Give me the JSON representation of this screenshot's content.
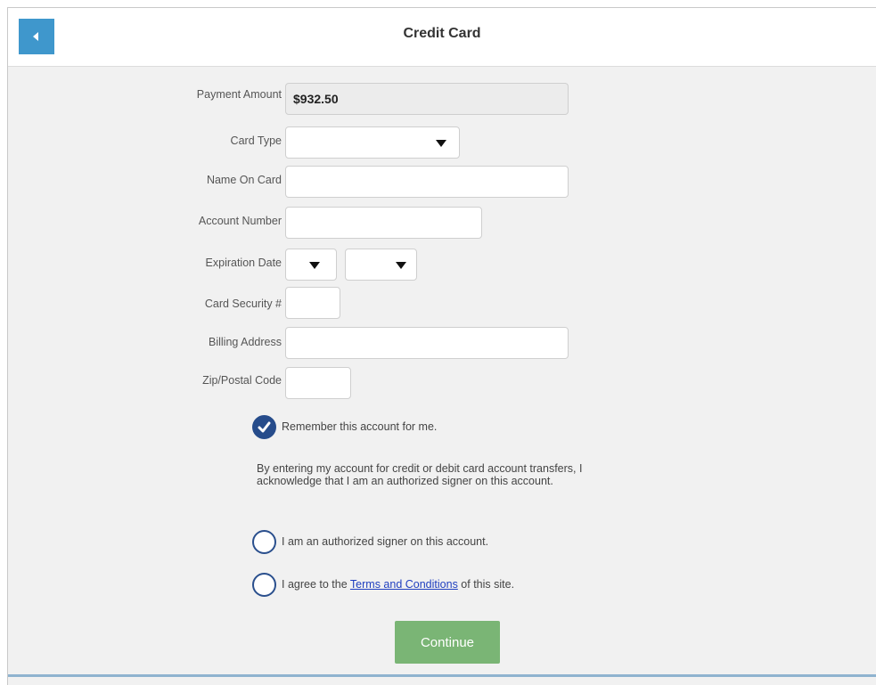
{
  "header": {
    "title": "Credit Card",
    "back_icon": "back-arrow-icon"
  },
  "form": {
    "payment_amount": {
      "label": "Payment Amount",
      "value": "$932.50"
    },
    "card_type": {
      "label": "Card Type",
      "value": ""
    },
    "name_on_card": {
      "label": "Name On Card",
      "value": ""
    },
    "account_number": {
      "label": "Account Number",
      "value": ""
    },
    "expiration_date": {
      "label": "Expiration Date",
      "month": "",
      "year": ""
    },
    "card_security": {
      "label": "Card Security #",
      "value": ""
    },
    "billing_address": {
      "label": "Billing Address",
      "value": ""
    },
    "zip_code": {
      "label": "Zip/Postal Code",
      "value": ""
    }
  },
  "options": {
    "remember": {
      "label": "Remember this account for me.",
      "checked": true
    },
    "notice": "By entering my account for credit or debit card account transfers, I acknowledge that I am an authorized signer on this account.",
    "authorized": {
      "label": "I am an authorized signer on this account.",
      "checked": false
    },
    "terms": {
      "prefix": "I agree to the ",
      "link": "Terms and Conditions",
      "suffix": " of this site.",
      "checked": false
    }
  },
  "actions": {
    "continue_label": "Continue"
  },
  "colors": {
    "accent": "#3f97cc",
    "check": "#264c8b",
    "continue": "#7ab575"
  }
}
